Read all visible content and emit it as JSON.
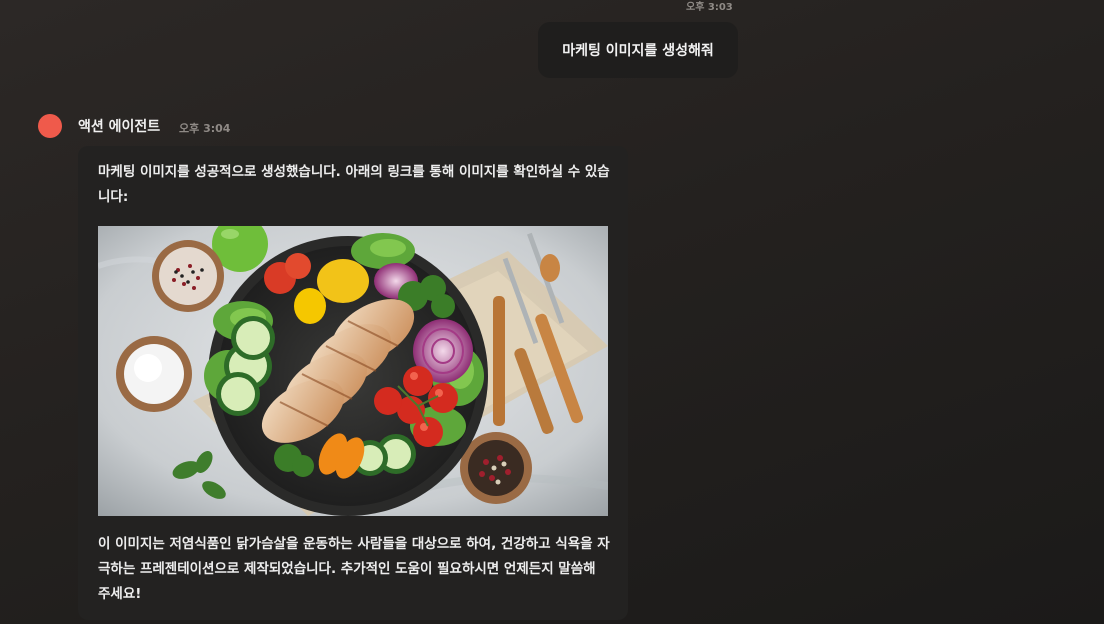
{
  "user_message": {
    "time": "오후 3:03",
    "text": "마케팅 이미지를 생성해줘"
  },
  "agent_message": {
    "name": "액션 에이전트",
    "time": "오후 3:04",
    "intro": "마케팅 이미지를 성공적으로 생성했습니다. 아래의 링크를 통해 이미지를 확인하실 수 있습니다:",
    "outro": "이 이미지는 저염식품인 닭가슴살을 운동하는 사람들을 대상으로 하여, 건강하고 식욕을 자극하는 프레젠테이션으로 제작되었습니다. 추가적인 도움이 필요하시면 언제든지 말씀해 주세요!",
    "avatar_color": "#ef5a4b"
  },
  "generated_image": {
    "subject": "chicken-breast-salad-bowl"
  },
  "colors": {
    "background": "#24211f",
    "bubble": "#232221",
    "user_bubble": "#1f1e1d",
    "text": "#ededed",
    "meta": "#8f8a86"
  }
}
